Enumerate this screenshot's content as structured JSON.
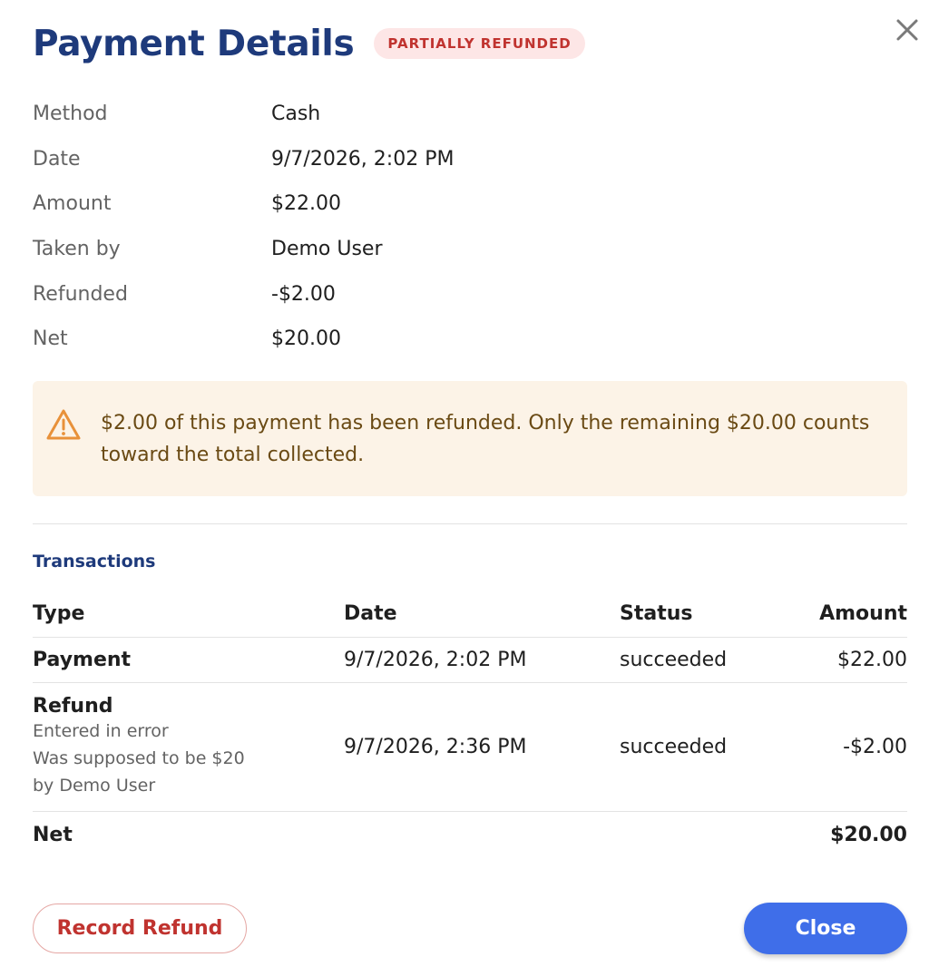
{
  "header": {
    "title": "Payment Details",
    "status_badge": "PARTIALLY REFUNDED"
  },
  "details": [
    {
      "label": "Method",
      "value": "Cash"
    },
    {
      "label": "Date",
      "value": "9/7/2026, 2:02 PM"
    },
    {
      "label": "Amount",
      "value": "$22.00"
    },
    {
      "label": "Taken by",
      "value": "Demo User"
    },
    {
      "label": "Refunded",
      "value": "-$2.00"
    },
    {
      "label": "Net",
      "value": "$20.00"
    }
  ],
  "notice": {
    "icon": "warning-icon",
    "text": "$2.00 of this payment has been refunded. Only the remaining $20.00 counts toward the total collected."
  },
  "transactions": {
    "section_title": "Transactions",
    "columns": [
      "Type",
      "Date",
      "Status",
      "Amount"
    ],
    "rows": [
      {
        "type": "Payment",
        "date": "9/7/2026, 2:02 PM",
        "status": "succeeded",
        "amount": "$22.00"
      },
      {
        "type": "Refund",
        "reason": "Entered in error",
        "note": "Was supposed to be $20",
        "by": "by Demo User",
        "date": "9/7/2026, 2:36 PM",
        "status": "succeeded",
        "amount": "-$2.00"
      }
    ],
    "net": {
      "label": "Net",
      "amount": "$20.00"
    }
  },
  "actions": {
    "record_refund_label": "Record Refund",
    "close_label": "Close"
  },
  "colors": {
    "title": "#1e3a7b",
    "badge_bg": "#fde6e6",
    "badge_text": "#c0332f",
    "notice_bg": "#fcf3e7",
    "warning_icon": "#e8913a",
    "negative_amount": "#c0332f",
    "primary_button": "#3f6ee9"
  }
}
